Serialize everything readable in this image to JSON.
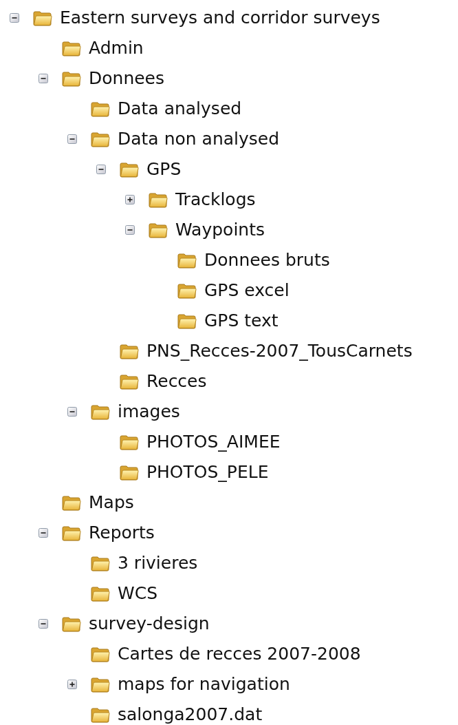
{
  "tree": [
    {
      "label": "Eastern surveys and corridor surveys",
      "expanded": true,
      "children": [
        {
          "label": "Admin"
        },
        {
          "label": "Donnees",
          "expanded": true,
          "children": [
            {
              "label": "Data analysed"
            },
            {
              "label": "Data non analysed",
              "expanded": true,
              "children": [
                {
                  "label": "GPS",
                  "expanded": true,
                  "children": [
                    {
                      "label": "Tracklogs",
                      "expanded": false
                    },
                    {
                      "label": "Waypoints",
                      "expanded": true,
                      "children": [
                        {
                          "label": "Donnees bruts"
                        },
                        {
                          "label": "GPS excel"
                        },
                        {
                          "label": "GPS text"
                        }
                      ]
                    }
                  ]
                },
                {
                  "label": "PNS_Recces-2007_TousCarnets"
                },
                {
                  "label": "Recces"
                }
              ]
            },
            {
              "label": "images",
              "expanded": true,
              "children": [
                {
                  "label": "PHOTOS_AIMEE"
                },
                {
                  "label": "PHOTOS_PELE"
                }
              ]
            }
          ]
        },
        {
          "label": "Maps"
        },
        {
          "label": "Reports",
          "expanded": true,
          "children": [
            {
              "label": "3 rivieres"
            },
            {
              "label": "WCS"
            }
          ]
        },
        {
          "label": "survey-design",
          "expanded": true,
          "children": [
            {
              "label": "Cartes de recces 2007-2008"
            },
            {
              "label": "maps for navigation",
              "expanded": false
            },
            {
              "label": "salonga2007.dat"
            }
          ]
        }
      ]
    }
  ]
}
